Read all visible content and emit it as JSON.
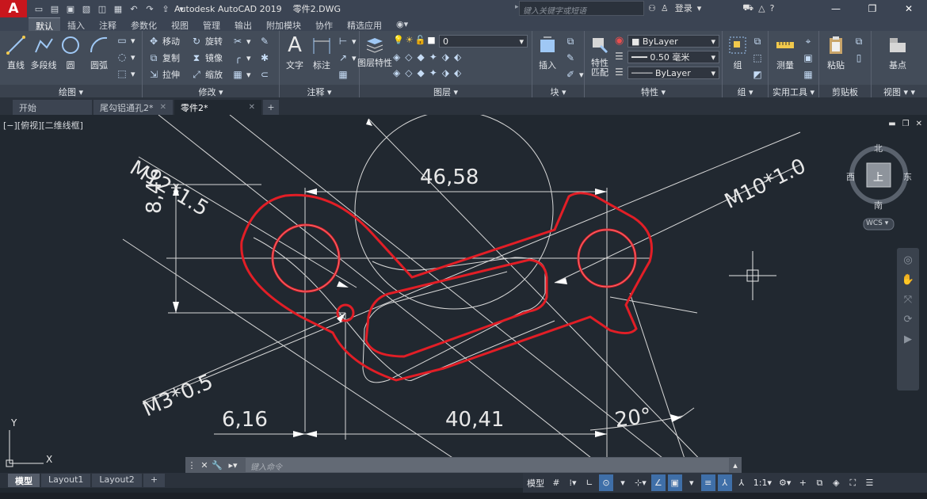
{
  "title": {
    "app": "Autodesk AutoCAD 2019",
    "file": "零件2.DWG",
    "search_placeholder": "键入关键字或短语",
    "login": "登录",
    "logo": "A"
  },
  "ribbon_tabs": [
    "默认",
    "插入",
    "注释",
    "参数化",
    "视图",
    "管理",
    "输出",
    "附加模块",
    "协作",
    "精选应用"
  ],
  "ribbon": {
    "draw": {
      "title": "绘图",
      "line": "直线",
      "polyline": "多段线",
      "circle": "圆",
      "arc": "圆弧"
    },
    "modify": {
      "title": "修改",
      "move": "移动",
      "rotate": "旋转",
      "copy": "复制",
      "mirror": "镜像",
      "stretch": "拉伸",
      "scale": "缩放"
    },
    "annotation": {
      "title": "注释",
      "text": "文字",
      "dim": "标注"
    },
    "layers": {
      "title": "图层",
      "props": "图层特性",
      "props_line2": "特性",
      "current": "0"
    },
    "block": {
      "title": "块",
      "insert": "插入"
    },
    "properties": {
      "title": "特性",
      "match": "特性",
      "match_line2": "匹配",
      "color": "ByLayer",
      "lineweight": "0.50 毫米",
      "linetype": "ByLayer"
    },
    "groups": {
      "title": "组",
      "group": "组"
    },
    "utilities": {
      "title": "实用工具",
      "measure": "测量"
    },
    "clipboard": {
      "title": "剪贴板",
      "paste": "粘贴"
    },
    "view": {
      "title": "视图",
      "base": "基点"
    }
  },
  "doc_tabs": [
    "开始",
    "尾勾铝通孔2*",
    "零件2*"
  ],
  "viewport": {
    "label": "[−][俯视][二维线框]",
    "compass": {
      "north": "北",
      "south": "南",
      "east": "东",
      "west": "西",
      "top": "上",
      "wcs": "WCS"
    },
    "ucs_x": "X",
    "ucs_y": "Y"
  },
  "drawing_annotations": {
    "dim_top": "46,58",
    "dim_left_vert": "8,46",
    "dim_bottom_left": "6,16",
    "dim_bottom_right": "40,41",
    "dim_angle": "20°",
    "label_m12": "M12*1.5",
    "label_m10": "M10*1.0",
    "label_m3": "M3*0.5"
  },
  "command": {
    "placeholder": "键入命令"
  },
  "layout_tabs": [
    "模型",
    "Layout1",
    "Layout2"
  ],
  "status": {
    "model": "模型",
    "scale": "1:1"
  },
  "colors": {
    "part_red": "#e21e26",
    "dim_white": "#e8e8e8",
    "bg": "#212830"
  }
}
